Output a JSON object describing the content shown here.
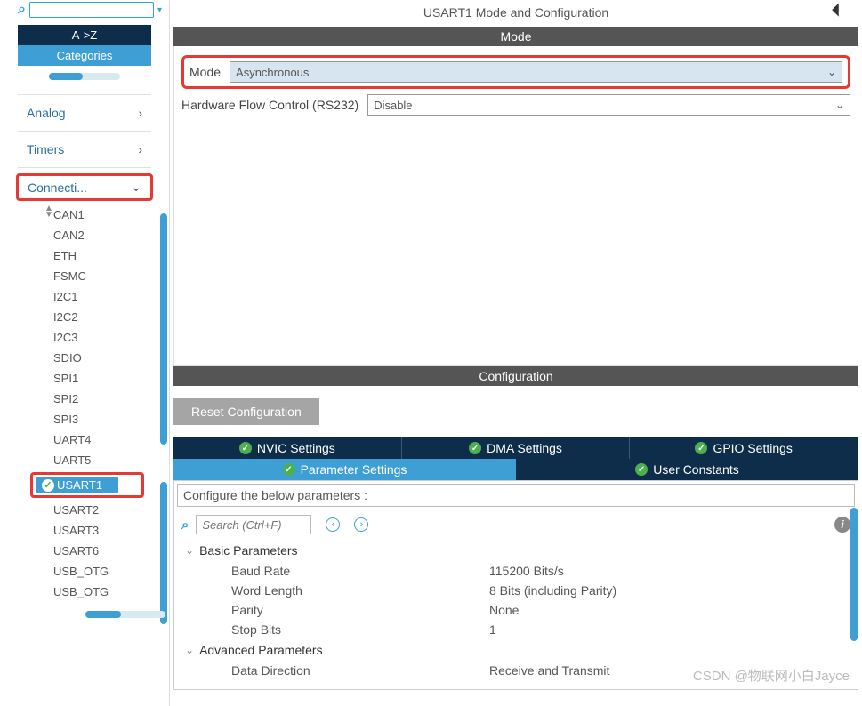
{
  "sidebar": {
    "tab_az": "A->Z",
    "tab_categories": "Categories",
    "groups": {
      "analog": "Analog",
      "timers": "Timers",
      "connectivity": "Connecti..."
    },
    "items": [
      "CAN1",
      "CAN2",
      "ETH",
      "FSMC",
      "I2C1",
      "I2C2",
      "I2C3",
      "SDIO",
      "SPI1",
      "SPI2",
      "SPI3",
      "UART4",
      "UART5",
      "USART1",
      "USART2",
      "USART3",
      "USART6",
      "USB_OTG",
      "USB_OTG"
    ],
    "selected": "USART1"
  },
  "main": {
    "title": "USART1 Mode and Configuration",
    "mode_header": "Mode",
    "mode_label": "Mode",
    "mode_value": "Asynchronous",
    "flowctl_label": "Hardware Flow Control (RS232)",
    "flowctl_value": "Disable",
    "config_header": "Configuration",
    "reset_btn": "Reset Configuration",
    "tabs1": [
      "NVIC Settings",
      "DMA Settings",
      "GPIO Settings"
    ],
    "tabs2": [
      "Parameter Settings",
      "User Constants"
    ],
    "hint": "Configure the below parameters :",
    "search_placeholder": "Search (Ctrl+F)",
    "groups": {
      "basic": "Basic Parameters",
      "advanced": "Advanced Parameters"
    },
    "params": {
      "baud_k": "Baud Rate",
      "baud_v": "115200 Bits/s",
      "word_k": "Word Length",
      "word_v": "8 Bits (including Parity)",
      "parity_k": "Parity",
      "parity_v": "None",
      "stop_k": "Stop Bits",
      "stop_v": "1",
      "dir_k": "Data Direction",
      "dir_v": "Receive and Transmit"
    }
  },
  "watermark": "CSDN @物联网小白Jayce"
}
